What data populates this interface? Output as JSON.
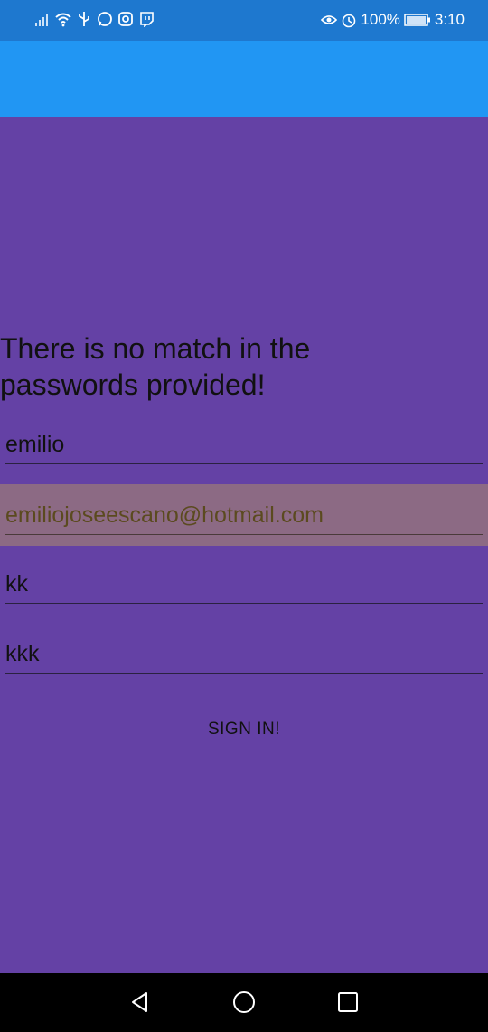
{
  "status_bar": {
    "battery_percent": "100%",
    "time": "3:10",
    "left_icons": [
      "signal-icon",
      "wifi-icon",
      "usb-icon",
      "whatsapp-icon",
      "instagram-icon",
      "twitch-icon"
    ],
    "right_icons": [
      "eye-icon",
      "alarm-icon",
      "battery-icon"
    ]
  },
  "main": {
    "error_message": "There is no match in the passwords provided!",
    "fields": {
      "username": "emilio",
      "email": "emiliojoseescano@hotmail.com",
      "password": "kk",
      "confirm_password": "kkk"
    },
    "signin_label": "SIGN IN!"
  },
  "nav_bar": {
    "buttons": [
      "back-icon",
      "home-icon",
      "recents-icon"
    ]
  },
  "colors": {
    "status_bar": "#1E78CF",
    "app_bar": "#2196F3",
    "background": "#6441A5",
    "focused_field": "#8C6A84"
  }
}
